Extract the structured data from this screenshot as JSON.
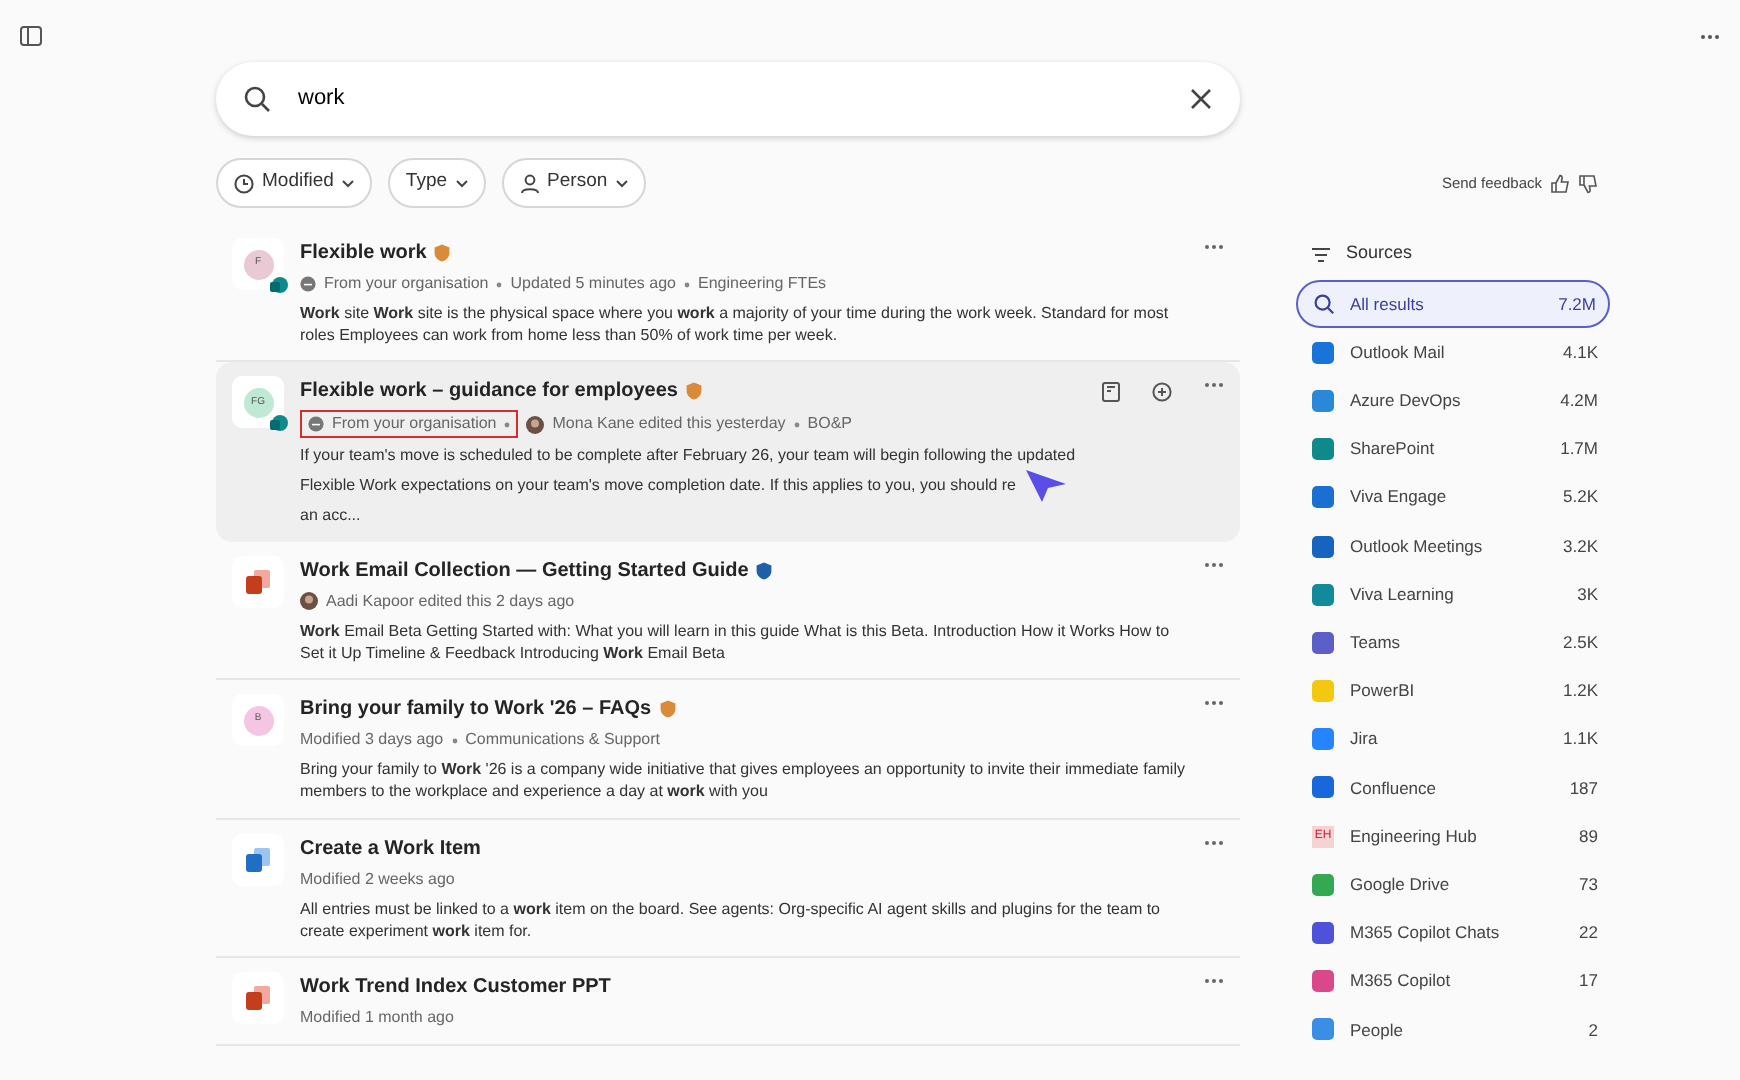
{
  "search": {
    "value": "work"
  },
  "filters": [
    {
      "label": "Modified",
      "kind": "clock"
    },
    {
      "label": "Type",
      "kind": "none"
    },
    {
      "label": "Person",
      "kind": "person"
    }
  ],
  "feedback": {
    "label": "Send feedback"
  },
  "results": [
    {
      "title": "Flexible work",
      "icon": {
        "kind": "avatar",
        "text": "F",
        "color": "#e9c9d3"
      },
      "site_badge": true,
      "badge": {
        "color": "#d98b3a"
      },
      "hovered": false,
      "meta": [
        {
          "kind": "org",
          "text": "From your organisation",
          "highlighted": false
        },
        {
          "kind": "text",
          "text": "Updated 5 minutes ago"
        },
        {
          "kind": "text",
          "text": "Engineering FTEs"
        }
      ],
      "snippet": "**Work** site **Work** site is the physical space where you **work** a majority of your time during the work week. Standard for most roles Employees can work from home less than 50% of work time per week."
    },
    {
      "title": "Flexible work – guidance for employees",
      "icon": {
        "kind": "avatar",
        "text": "FG",
        "color": "#bfe8d5"
      },
      "site_badge": true,
      "badge": {
        "color": "#d98b3a"
      },
      "hovered": true,
      "meta": [
        {
          "kind": "org",
          "text": "From your organisation",
          "highlighted": true
        },
        {
          "kind": "person",
          "text": "Mona Kane edited this yesterday"
        },
        {
          "kind": "text",
          "text": "BO&P"
        }
      ],
      "snippet": "If your team's move is scheduled to be complete after February 26, your team will begin following the updated Flexible Work expectations on your team's move completion date. If this applies to you, you should re",
      "snippet_after_cursor": "an acc..."
    },
    {
      "title": "**Work** Email Collection — Getting Started Guide",
      "icon": {
        "kind": "ppt"
      },
      "site_badge": false,
      "badge": {
        "color": "#1f5fa8"
      },
      "hovered": false,
      "meta": [
        {
          "kind": "person",
          "text": "Aadi Kapoor edited this 2 days ago"
        }
      ],
      "snippet": "**Work** Email Beta Getting Started with: What you will learn in this guide What is this Beta. Introduction How it Works How to Set it Up Timeline & Feedback Introducing **Work** Email Beta"
    },
    {
      "title": "Bring your family to **Work** '26 – FAQs",
      "icon": {
        "kind": "avatar",
        "text": "B",
        "color": "#f4c6e4"
      },
      "site_badge": false,
      "badge": {
        "color": "#d98b3a"
      },
      "hovered": false,
      "meta": [
        {
          "kind": "text",
          "text": "Modified 3 days ago"
        },
        {
          "kind": "text",
          "text": "Communications & Support"
        }
      ],
      "snippet": "Bring your family to **Work** '26 is a company wide initiative that gives employees an opportunity to invite their immediate family members to the workplace and experience a day at **work** with you"
    },
    {
      "title": "Create a **Work** Item",
      "icon": {
        "kind": "devops"
      },
      "site_badge": false,
      "hovered": false,
      "meta": [
        {
          "kind": "text",
          "text": "Modified 2 weeks ago"
        }
      ],
      "snippet": "All entries must be linked to a **work** item on the board. See agents: Org-specific AI agent skills and plugins for the team to create experiment **work** item for."
    },
    {
      "title": "**Work** Trend Index Customer PPT",
      "icon": {
        "kind": "ppt"
      },
      "site_badge": false,
      "hovered": false,
      "meta": [
        {
          "kind": "text",
          "text": "Modified 1 month ago"
        }
      ]
    }
  ],
  "sources": {
    "title": "Sources",
    "items": [
      {
        "label": "All results",
        "count": "7.2M",
        "selected": true,
        "kind": "search"
      },
      {
        "label": "Outlook Mail",
        "count": "4.1K",
        "selected": false,
        "kind": "app",
        "color": "#1a73d9"
      },
      {
        "label": "Azure DevOps",
        "count": "4.2M",
        "selected": false,
        "kind": "app",
        "color": "#2b88d8"
      },
      {
        "label": "SharePoint",
        "count": "1.7M",
        "selected": false,
        "kind": "app",
        "color": "#0f8a8a"
      },
      {
        "label": "Viva Engage",
        "count": "5.2K",
        "selected": false,
        "kind": "app",
        "color": "#1b6fd1"
      },
      {
        "label": "Outlook Meetings",
        "count": "3.2K",
        "selected": false,
        "kind": "app",
        "color": "#1565c0"
      },
      {
        "label": "Viva Learning",
        "count": "3K",
        "selected": false,
        "kind": "app",
        "color": "#138a9c"
      },
      {
        "label": "Teams",
        "count": "2.5K",
        "selected": false,
        "kind": "app",
        "color": "#5b5fc7"
      },
      {
        "label": "PowerBI",
        "count": "1.2K",
        "selected": false,
        "kind": "app",
        "color": "#f2c811"
      },
      {
        "label": "Jira",
        "count": "1.1K",
        "selected": false,
        "kind": "app",
        "color": "#2684ff"
      },
      {
        "label": "Confluence",
        "count": "187",
        "selected": false,
        "kind": "app",
        "color": "#1868db"
      },
      {
        "label": "Engineering Hub",
        "count": "89",
        "selected": false,
        "kind": "initials",
        "text": "EH",
        "color": "#f6d3d3"
      },
      {
        "label": "Google Drive",
        "count": "73",
        "selected": false,
        "kind": "app",
        "color": "#34a853"
      },
      {
        "label": "M365 Copilot Chats",
        "count": "22",
        "selected": false,
        "kind": "app",
        "color": "#4f52d9"
      },
      {
        "label": "M365 Copilot",
        "count": "17",
        "selected": false,
        "kind": "app",
        "color": "#d9488b"
      },
      {
        "label": "People",
        "count": "2",
        "selected": false,
        "kind": "app",
        "color": "#3a8ee6"
      }
    ]
  }
}
